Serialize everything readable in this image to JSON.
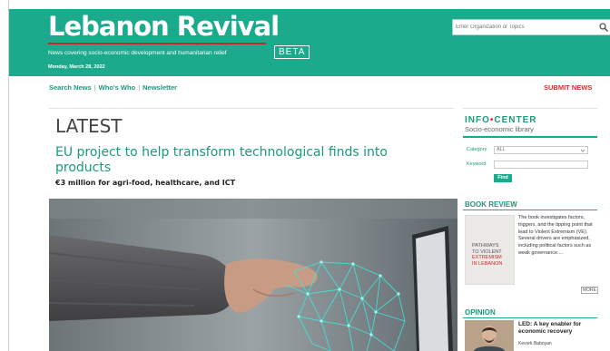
{
  "header": {
    "logo": "Lebanon Revival",
    "beta": "BETA",
    "tagline": "News covering socio-economic development and humanitarian relief",
    "date": "Monday, March 28, 2022",
    "search_placeholder": "Enter Organization or Topics"
  },
  "nav": {
    "items": [
      "Search News",
      "Who's Who",
      "Newsletter"
    ],
    "submit": "SUBMIT NEWS"
  },
  "main": {
    "section": "LATEST",
    "headline": "EU project to help transform technological finds into products",
    "subhead": "€3 million for agri-food, healthcare, and ICT"
  },
  "sidebar": {
    "info_center_a": "INFO",
    "info_center_dot": "•",
    "info_center_b": "CENTER",
    "info_sub": "Socio-economic library",
    "category_label": "Category",
    "category_value": "ALL",
    "keyword_label": "Keyword",
    "find_button": "Find",
    "book_review_title": "BOOK REVIEW",
    "book_cover": [
      "PATHWAYS",
      "TO VIOLENT",
      "EXTREMISM",
      "IN LEBANON"
    ],
    "book_review_text": "The book investigates factors, triggers, and the tipping point that lead to Violent Extremism (VE). Several drivers are emphasized, including political factors such as weak governance....",
    "more": "MORE",
    "opinion_title": "OPINION",
    "opinion_headline": "LED: A key enabler for economic recovery",
    "opinion_author": "Kevork Baboyan"
  },
  "colors": {
    "brand_green": "#1bab8c",
    "accent_red": "#d32f2f"
  }
}
